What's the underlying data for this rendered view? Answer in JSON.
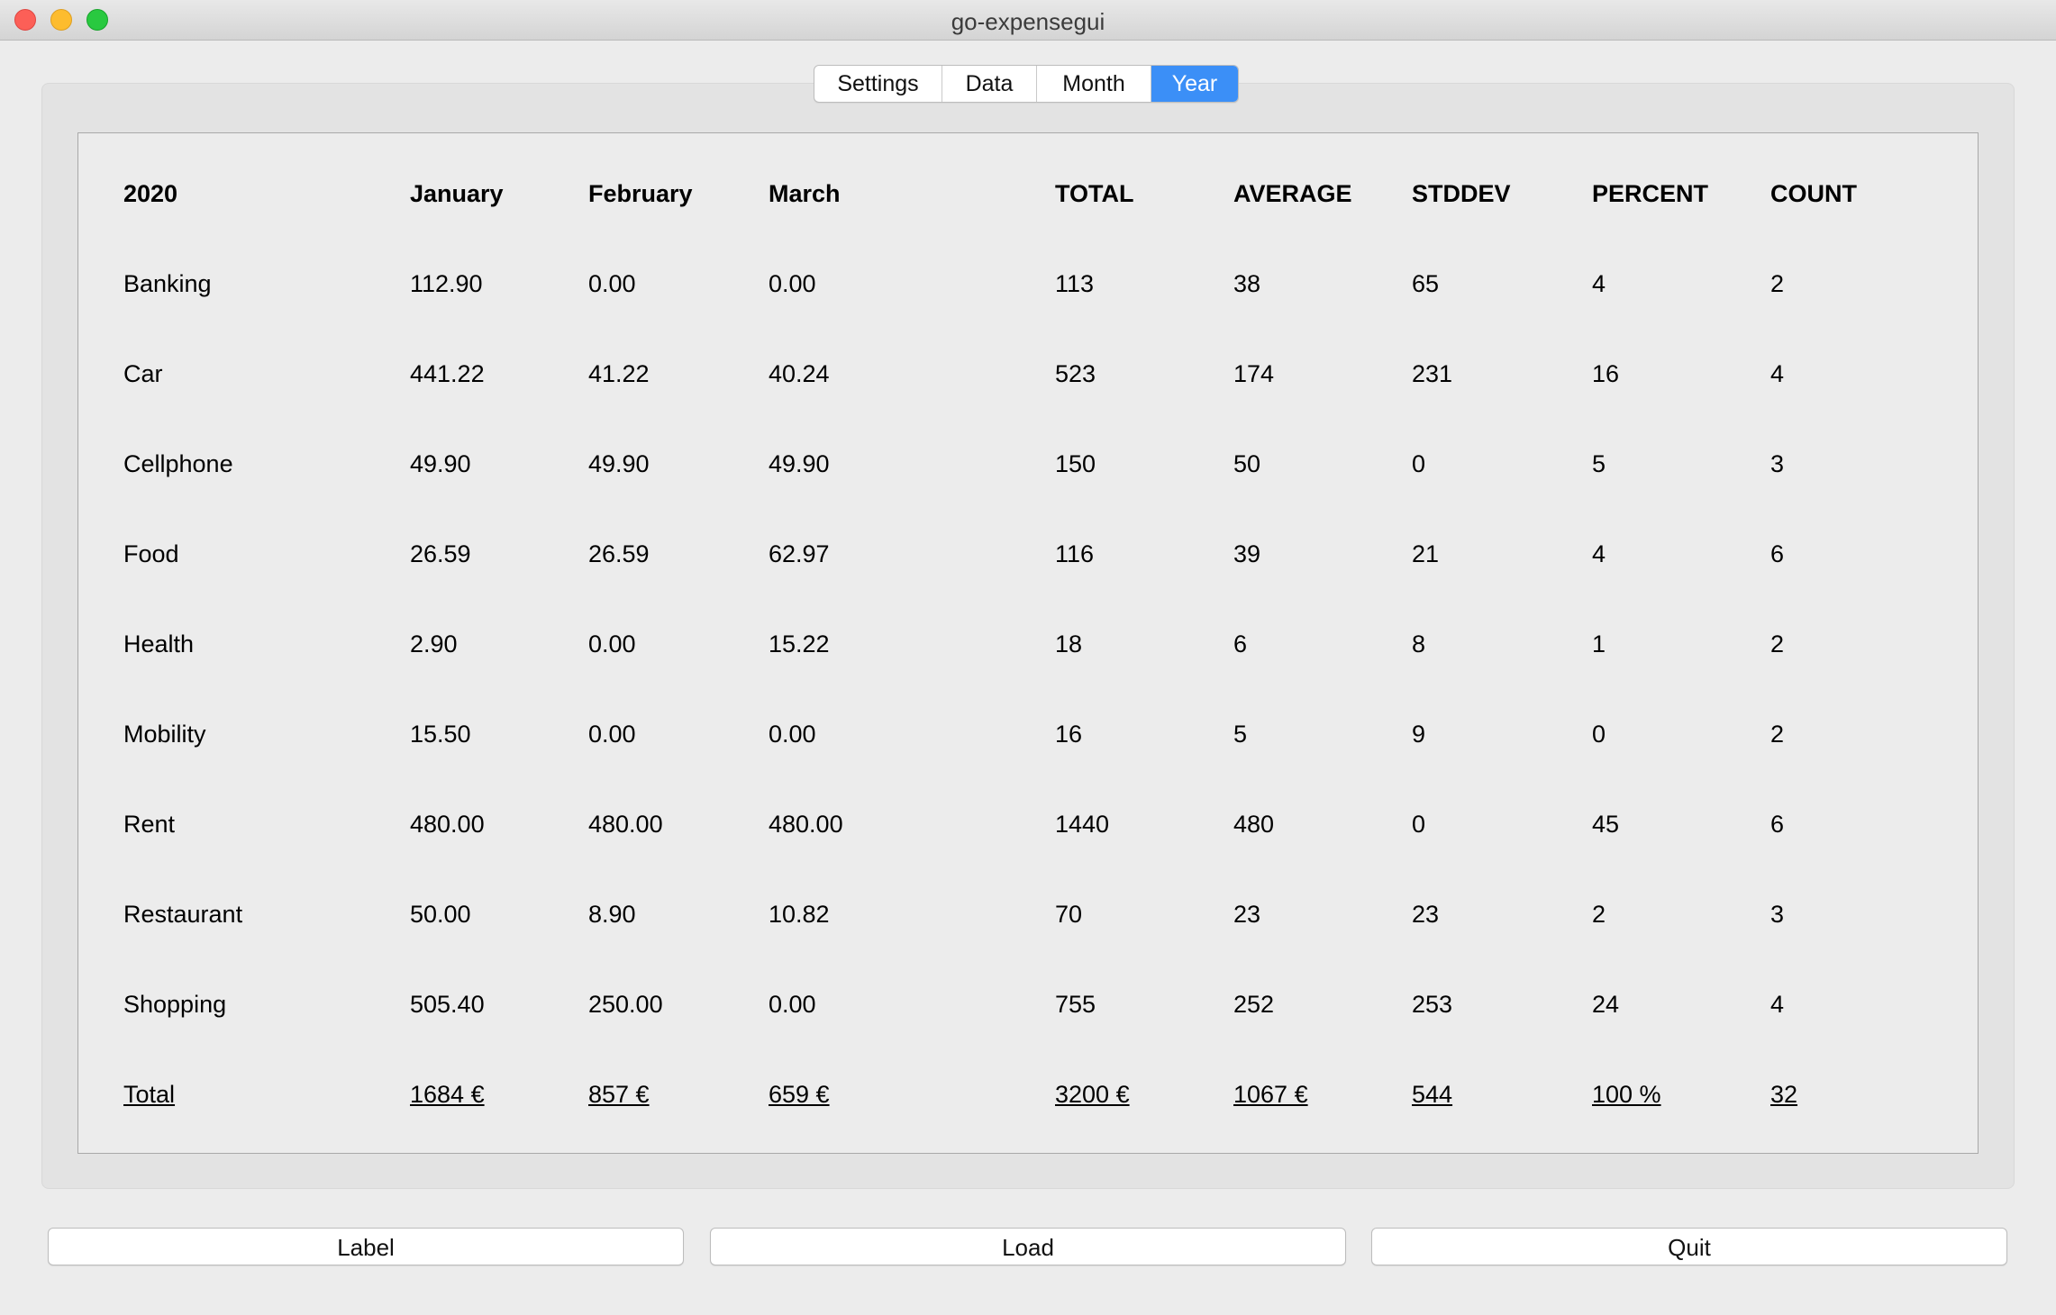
{
  "window": {
    "title": "go-expensegui"
  },
  "tabs": [
    {
      "label": "Settings"
    },
    {
      "label": "Data"
    },
    {
      "label": "Month"
    },
    {
      "label": "Year"
    }
  ],
  "active_tab": "Year",
  "colors": {
    "accent": "#3b8ff7"
  },
  "table": {
    "headers": [
      "2020",
      "January",
      "February",
      "March",
      "TOTAL",
      "AVERAGE",
      "STDDEV",
      "PERCENT",
      "COUNT"
    ],
    "rows": [
      [
        "Banking",
        "112.90",
        "0.00",
        "0.00",
        "113",
        "38",
        "65",
        "4",
        "2"
      ],
      [
        "Car",
        "441.22",
        "41.22",
        "40.24",
        "523",
        "174",
        "231",
        "16",
        "4"
      ],
      [
        "Cellphone",
        "49.90",
        "49.90",
        "49.90",
        "150",
        "50",
        "0",
        "5",
        "3"
      ],
      [
        "Food",
        "26.59",
        "26.59",
        "62.97",
        "116",
        "39",
        "21",
        "4",
        "6"
      ],
      [
        "Health",
        "2.90",
        "0.00",
        "15.22",
        "18",
        "6",
        "8",
        "1",
        "2"
      ],
      [
        "Mobility",
        "15.50",
        "0.00",
        "0.00",
        "16",
        "5",
        "9",
        "0",
        "2"
      ],
      [
        "Rent",
        "480.00",
        "480.00",
        "480.00",
        "1440",
        "480",
        "0",
        "45",
        "6"
      ],
      [
        "Restaurant",
        "50.00",
        "8.90",
        "10.82",
        "70",
        "23",
        "23",
        "2",
        "3"
      ],
      [
        "Shopping",
        "505.40",
        "250.00",
        "0.00",
        "755",
        "252",
        "253",
        "24",
        "4"
      ]
    ],
    "total": [
      "Total",
      "1684 €",
      "857 €",
      "659 €",
      "3200 €",
      "1067 €",
      "544",
      "100 %",
      "32"
    ]
  },
  "buttons": {
    "label": "Label",
    "load": "Load",
    "quit": "Quit"
  }
}
